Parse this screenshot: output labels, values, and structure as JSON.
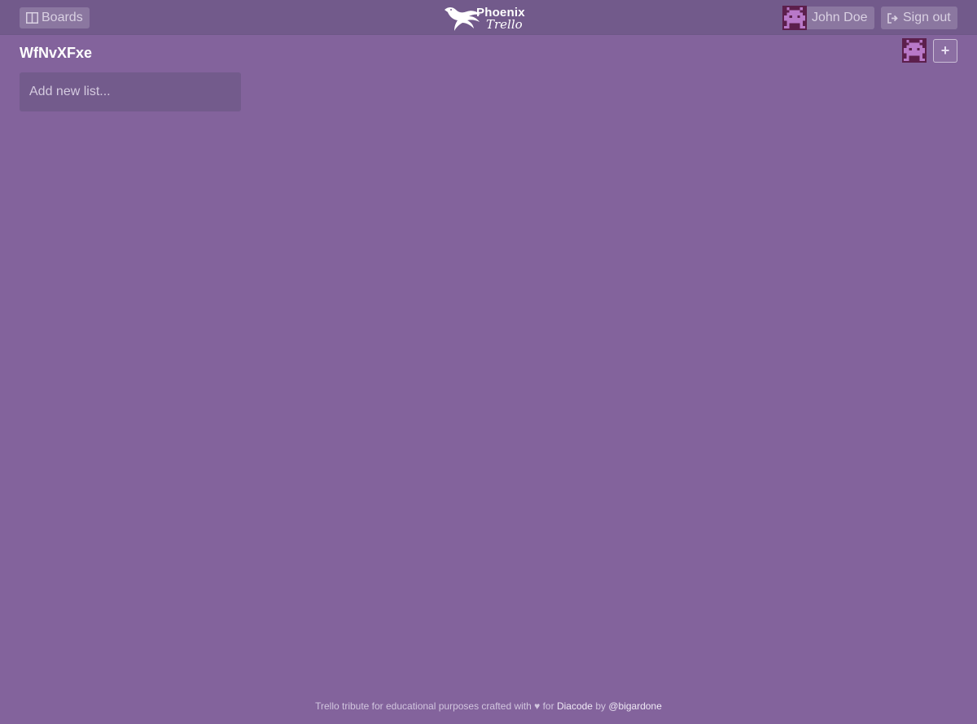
{
  "header": {
    "boards_label": "Boards",
    "logo_title": "Phoenix",
    "logo_subtitle": "Trello",
    "user_name": "John Doe",
    "signout_label": "Sign out"
  },
  "board": {
    "title": "WfNvXFxe",
    "add_member_label": "+",
    "add_list_placeholder": "Add new list..."
  },
  "footer": {
    "text": "Trello tribute for educational purposes crafted with ♥ for",
    "link1": "Diacode",
    "by": "by",
    "link2": "@bigardone"
  },
  "icons": {
    "boards": "columns-icon",
    "signout": "sign-out-icon",
    "logo": "phoenix-bird-icon",
    "avatar": "space-invader-avatar"
  },
  "colors": {
    "background": "#83639c",
    "header": "#725a8b",
    "avatar_bg": "#5c1f4c",
    "avatar_fg": "#b878c8"
  }
}
